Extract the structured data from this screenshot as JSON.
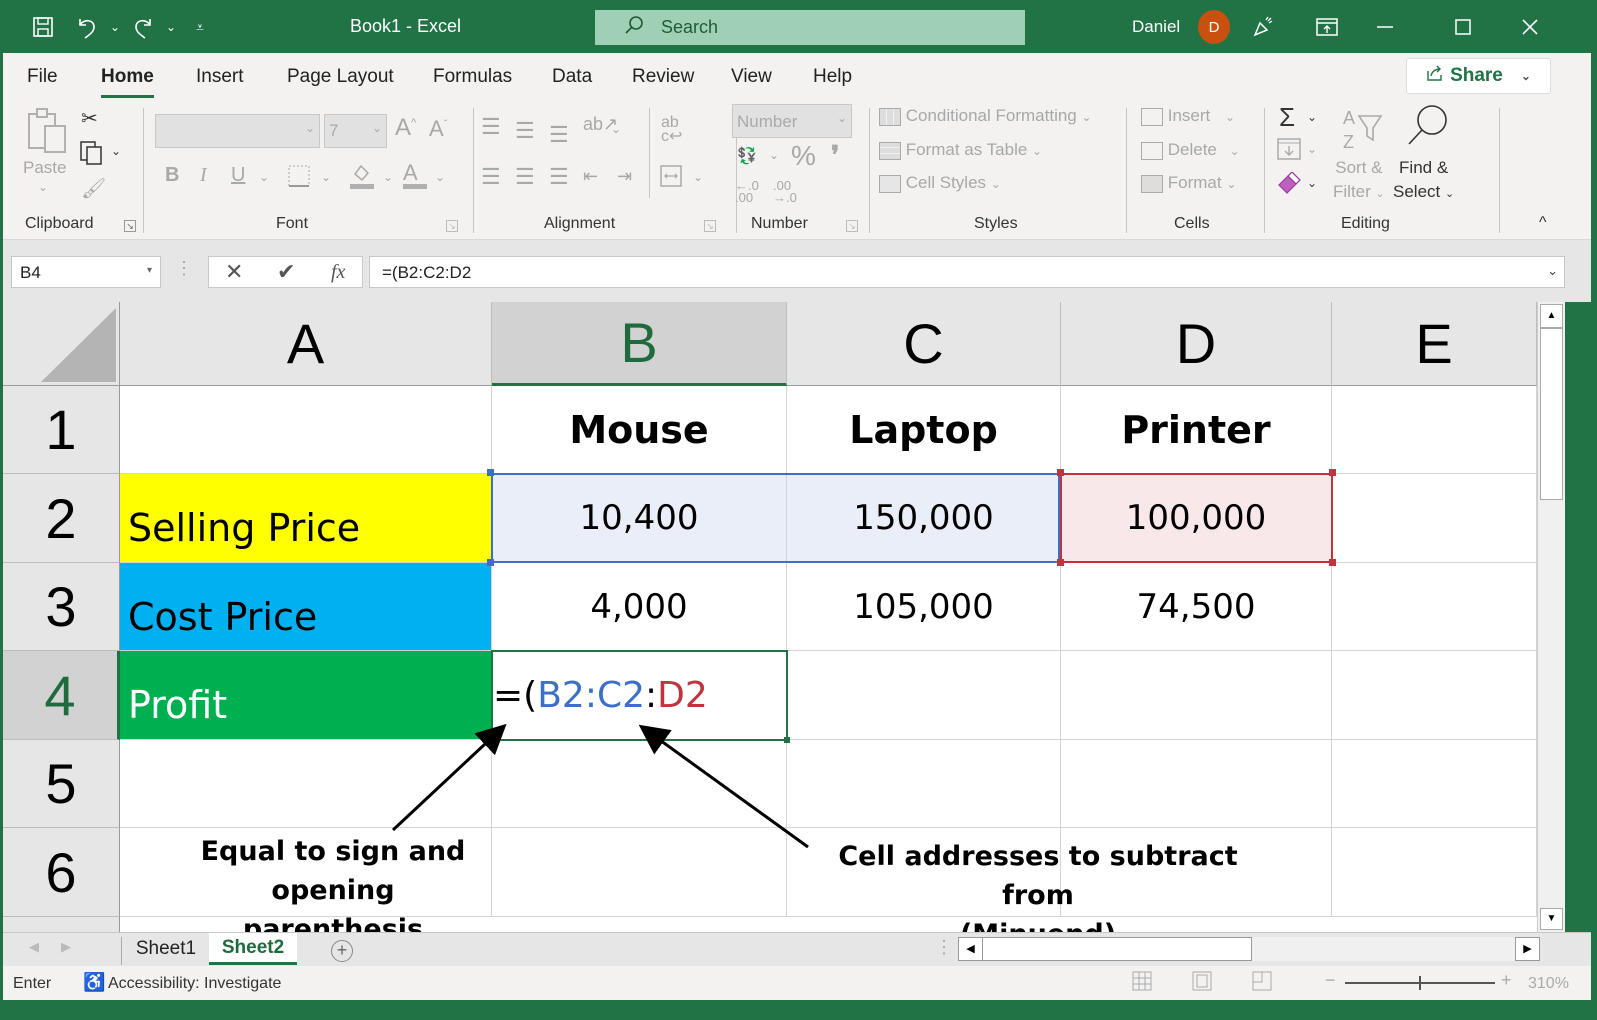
{
  "titlebar": {
    "title": "Book1  -  Excel",
    "search_placeholder": "Search",
    "user_name": "Daniel",
    "avatar_initial": "D",
    "avatar_color": "#ca5010"
  },
  "menu": {
    "tabs": [
      "File",
      "Home",
      "Insert",
      "Page Layout",
      "Formulas",
      "Data",
      "Review",
      "View",
      "Help"
    ],
    "active": "Home",
    "share_label": "Share"
  },
  "ribbon": {
    "clipboard": {
      "label": "Clipboard",
      "paste": "Paste"
    },
    "font": {
      "label": "Font",
      "font_name": "",
      "font_size": "7",
      "bold": "B",
      "italic": "I",
      "underline": "U"
    },
    "alignment": {
      "label": "Alignment"
    },
    "number": {
      "label": "Number",
      "format": "Number",
      "percent": "%",
      "comma": "❜",
      "inc_decimal": "←.0 .00",
      "dec_decimal": ".00 →.0"
    },
    "styles": {
      "label": "Styles",
      "conditional_formatting": "Conditional Formatting",
      "format_as_table": "Format as Table",
      "cell_styles": "Cell Styles"
    },
    "cells": {
      "label": "Cells",
      "insert": "Insert",
      "delete": "Delete",
      "format": "Format"
    },
    "editing": {
      "label": "Editing",
      "sort_filter_1": "Sort &",
      "sort_filter_2": "Filter",
      "find_select_1": "Find &",
      "find_select_2": "Select"
    }
  },
  "formula_bar": {
    "name_box": "B4",
    "formula": "=(B2:C2:D2",
    "fx": "fx"
  },
  "grid": {
    "columns": [
      "A",
      "B",
      "C",
      "D",
      "E"
    ],
    "selected_column": "B",
    "rows": [
      "1",
      "2",
      "3",
      "4",
      "5",
      "6"
    ],
    "selected_row": "4",
    "row1": {
      "B": "Mouse",
      "C": "Laptop",
      "D": "Printer"
    },
    "row2": {
      "A": "Selling Price",
      "B": "10,400",
      "C": "150,000",
      "D": "100,000"
    },
    "row3": {
      "A": "Cost Price",
      "B": "4,000",
      "C": "105,000",
      "D": "74,500"
    },
    "row4": {
      "A": "Profit",
      "B_parts": {
        "eq": "=(",
        "ref1": "B2:C2",
        "colon": ":",
        "ref2": "D2"
      }
    },
    "colors": {
      "selling_price_fill": "#ffff00",
      "cost_price_fill": "#00b0f0",
      "profit_fill": "#00b050",
      "ref_blue": "#3c6fc8",
      "ref_red": "#c0343f"
    }
  },
  "annotations": {
    "left_1": "Equal to sign and opening",
    "left_2": "parenthesis",
    "right_1": "Cell addresses to subtract from",
    "right_2": "(Minuend)"
  },
  "sheets": {
    "tabs": [
      "Sheet1",
      "Sheet2"
    ],
    "active": "Sheet2",
    "add_label": "+"
  },
  "status": {
    "mode": "Enter",
    "accessibility": "Accessibility: Investigate",
    "zoom": "310%"
  }
}
